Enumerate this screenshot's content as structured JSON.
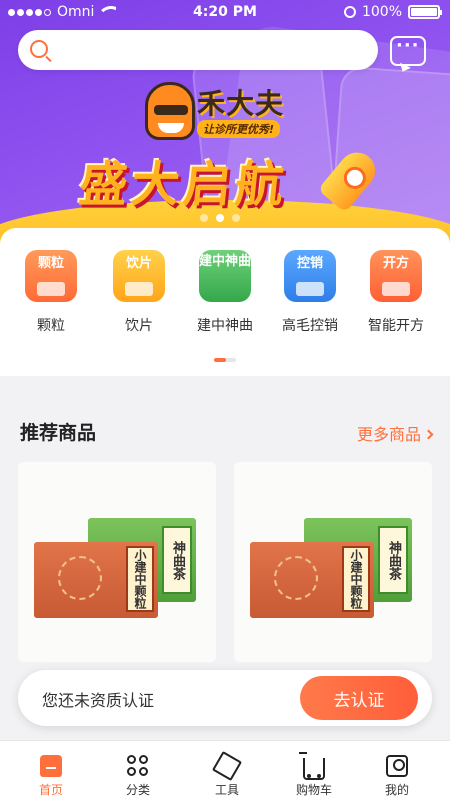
{
  "status_bar": {
    "carrier": "Omni",
    "time": "4:20 PM",
    "battery": "100%"
  },
  "search": {
    "placeholder": ""
  },
  "banner": {
    "brand": "禾大夫",
    "slogan": "让诊所更优秀!",
    "headline": "盛大启航",
    "slide_count": 3,
    "active_slide": 2
  },
  "categories": [
    {
      "tile_text": "颗粒",
      "label": "颗粒",
      "color": "#ff7a45"
    },
    {
      "tile_text": "饮片",
      "label": "饮片",
      "color": "#ffb21a"
    },
    {
      "tile_text": "建中神曲",
      "label": "建中神曲",
      "color": "#4cbf5e"
    },
    {
      "tile_text": "控销",
      "label": "高毛控销",
      "color": "#3c8df0"
    },
    {
      "tile_text": "开方",
      "label": "智能开方",
      "color": "#ff6f3c"
    }
  ],
  "recommend": {
    "title": "推荐商品",
    "more": "更多商品",
    "products": [
      {
        "green_box": "神曲茶",
        "orange_box": "小建中颗粒"
      },
      {
        "green_box": "神曲茶",
        "orange_box": "小建中颗粒"
      }
    ]
  },
  "qualification": {
    "text": "您还未资质认证",
    "button": "去认证"
  },
  "tabbar": [
    {
      "label": "首页",
      "icon": "home-icon",
      "active": true
    },
    {
      "label": "分类",
      "icon": "category-icon",
      "active": false
    },
    {
      "label": "工具",
      "icon": "tools-icon",
      "active": false
    },
    {
      "label": "购物车",
      "icon": "cart-icon",
      "active": false
    },
    {
      "label": "我的",
      "icon": "profile-icon",
      "active": false
    }
  ],
  "colors": {
    "accent": "#ff6f3c",
    "banner_purple": "#8f52f0",
    "banner_yellow": "#ffb21a"
  }
}
